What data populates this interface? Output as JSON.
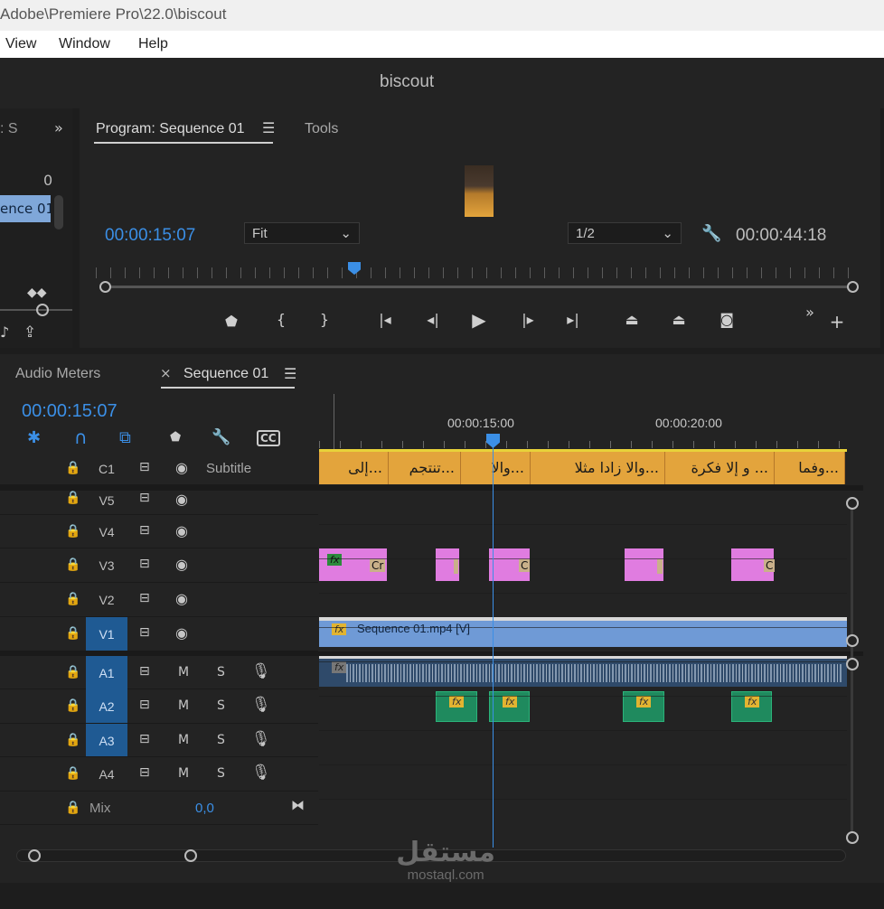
{
  "window": {
    "title": "Adobe\\Premiere Pro\\22.0\\biscout"
  },
  "menu": {
    "items": [
      "View",
      "Window",
      "Help"
    ]
  },
  "project": {
    "name": "biscout"
  },
  "left_panel": {
    "tab_fragment": ": S",
    "count": "0",
    "item": "ence 01."
  },
  "program": {
    "tab_label": "Program: Sequence 01",
    "tools_tab": "Tools",
    "current_tc": "00:00:15:07",
    "fit_value": "Fit",
    "resolution_value": "1/2",
    "duration_tc": "00:00:44:18"
  },
  "timeline": {
    "audio_meters_tab": "Audio Meters",
    "sequence_tab": "Sequence 01",
    "current_tc": "00:00:15:07",
    "ruler": {
      "t15": "00:00:15:00",
      "t20": "00:00:20:00"
    },
    "tracks": {
      "c1": {
        "label": "C1",
        "name": "Subtitle"
      },
      "v5": {
        "label": "V5"
      },
      "v4": {
        "label": "V4"
      },
      "v3": {
        "label": "V3"
      },
      "v2": {
        "label": "V2"
      },
      "v1": {
        "label": "V1"
      },
      "a1": {
        "label": "A1"
      },
      "a2": {
        "label": "A2"
      },
      "a3": {
        "label": "A3"
      },
      "a4": {
        "label": "A4"
      },
      "mix": {
        "label": "Mix",
        "value": "0,0"
      }
    },
    "mute": "M",
    "solo": "S",
    "captions": [
      "إلى...",
      "تنتجم...",
      "والا...",
      "والا زادا مثلا...",
      "و إلا فكرة ...",
      "وفما..."
    ],
    "v3_clip_text": "Cr",
    "v3_clip_text_short": "C",
    "v1_clip_name": "Sequence 01.mp4 [V]",
    "fx": "fx",
    "colors": {
      "caption": "#e3a43c",
      "pink": "#e07ce0",
      "video": "#6f9ad6",
      "audio": "#2f4a6a",
      "green": "#1f8a5e",
      "accent": "#3b8fe6"
    }
  },
  "watermark": {
    "arabic": "مستقل",
    "latin": "mostaql.com"
  }
}
